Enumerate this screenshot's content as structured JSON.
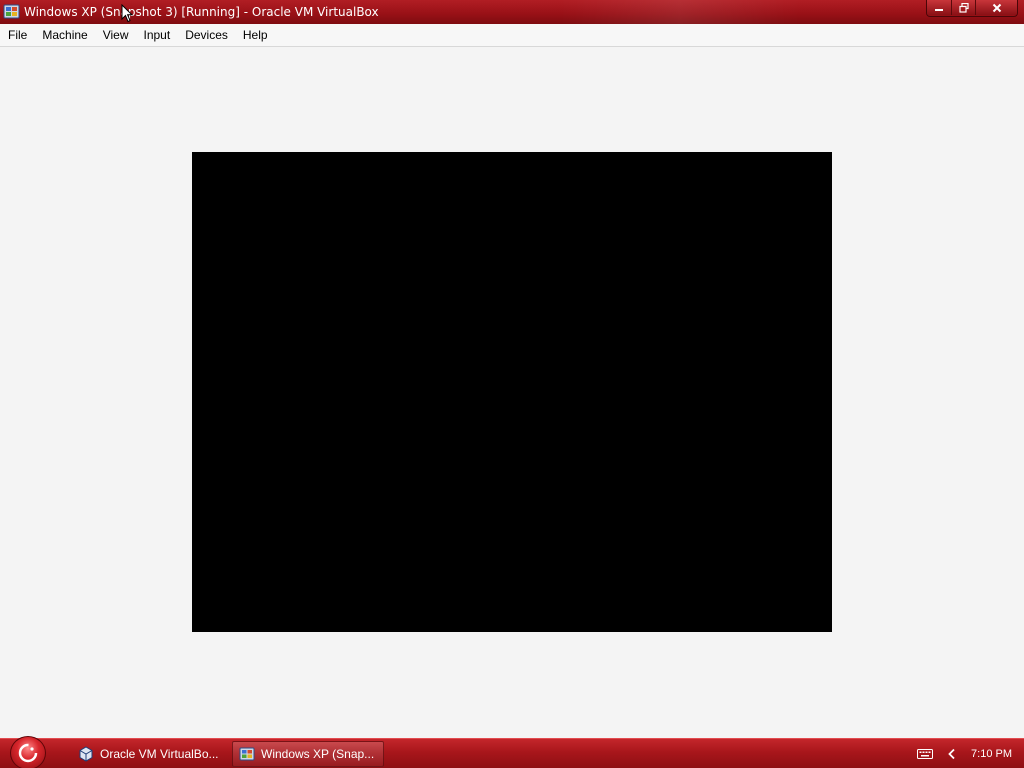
{
  "window": {
    "title": "Windows XP (Snapshot 3) [Running] - Oracle VM VirtualBox",
    "icon": "virtualbox-vm-icon",
    "controls": [
      "minimize",
      "restore",
      "close"
    ]
  },
  "menu": {
    "file": "File",
    "machine": "Machine",
    "view": "View",
    "input": "Input",
    "devices": "Devices",
    "help": "Help"
  },
  "taskbar": {
    "start_icon": "start-orb-icon",
    "tasks": [
      {
        "label": "Oracle VM VirtualBo...",
        "icon": "virtualbox-icon"
      },
      {
        "label": "Windows XP (Snap...",
        "icon": "virtualbox-vm-icon"
      }
    ],
    "tray": {
      "keyboard_icon": "keyboard-icon",
      "expand_icon": "chevron-left-icon",
      "clock": "7:10 PM"
    }
  },
  "colors": {
    "titlebar": "#9a1117",
    "taskbar": "#a8161b",
    "vm_screen": "#000000",
    "window_bg": "#f4f4f4"
  }
}
